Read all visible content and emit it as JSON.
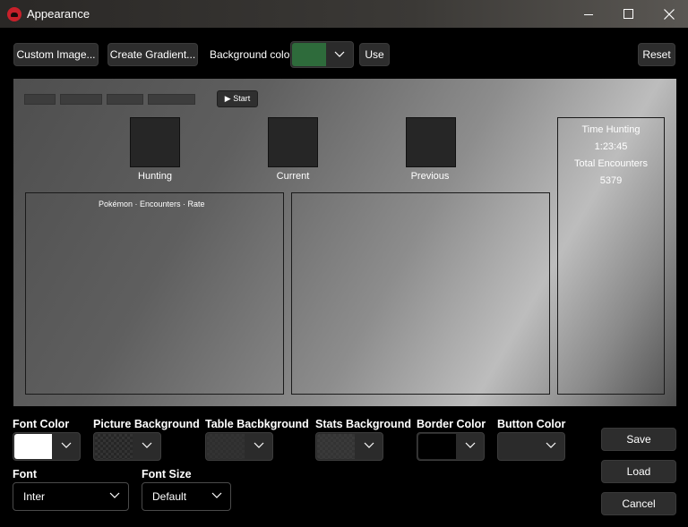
{
  "window": {
    "title": "Appearance"
  },
  "toolbar": {
    "custom_image": "Custom Image...",
    "create_gradient": "Create Gradient...",
    "background_color_label": "Background color",
    "background_color": "#2e6b3b",
    "use": "Use",
    "reset": "Reset"
  },
  "preview": {
    "start": "▶ Start",
    "pictures": [
      "Hunting",
      "Current",
      "Previous"
    ],
    "table_header": "Pokémon · Encounters · Rate",
    "stats": {
      "time_label": "Time Hunting",
      "time_value": "1:23:45",
      "encounters_label": "Total Encounters",
      "encounters_value": "5379"
    }
  },
  "colors": {
    "font_color": {
      "label": "Font Color",
      "value": "#ffffff"
    },
    "picture_background": {
      "label": "Picture Background",
      "value": "#262626"
    },
    "table_background": {
      "label": "Table Bacbkground",
      "value": "#2e2e2e"
    },
    "stats_background": {
      "label": "Stats Background",
      "value": "#3a3a3a"
    },
    "border_color": {
      "label": "Border Color",
      "value": "#000000"
    },
    "button_color": {
      "label": "Button Color",
      "value": "#2b2b2b"
    }
  },
  "font": {
    "label": "Font",
    "value": "Inter"
  },
  "font_size": {
    "label": "Font Size",
    "value": "Default"
  },
  "actions": {
    "save": "Save",
    "load": "Load",
    "cancel": "Cancel"
  }
}
